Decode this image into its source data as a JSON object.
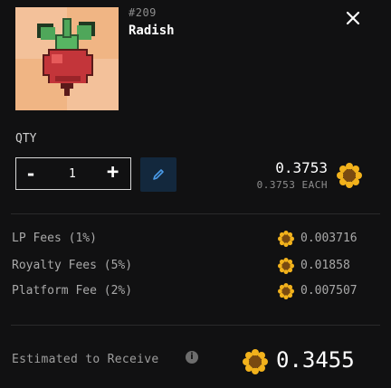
{
  "item": {
    "id": "#209",
    "name": "Radish"
  },
  "icons": {
    "close": "close-icon",
    "edit": "pencil-icon",
    "coin": "sunflower-coin-icon",
    "info": "info-icon",
    "thumbnail": "radish-pixel-art"
  },
  "quantity": {
    "label": "QTY",
    "minus": "-",
    "value": "1",
    "plus": "+"
  },
  "price": {
    "total": "0.3753",
    "each": "0.3753 EACH"
  },
  "fees": [
    {
      "label": "LP Fees (1%)",
      "value": "0.003716"
    },
    {
      "label": "Royalty Fees (5%)",
      "value": "0.01858"
    },
    {
      "label": "Platform Fee (2%)",
      "value": "0.007507"
    }
  ],
  "estimate": {
    "label": "Estimated to Receive",
    "info": "i",
    "value": "0.3455"
  },
  "colors": {
    "background": "#111112",
    "edit_button_bg": "#13283d",
    "coin_gold": "#f2b21c",
    "coin_center": "#7a4a10"
  }
}
